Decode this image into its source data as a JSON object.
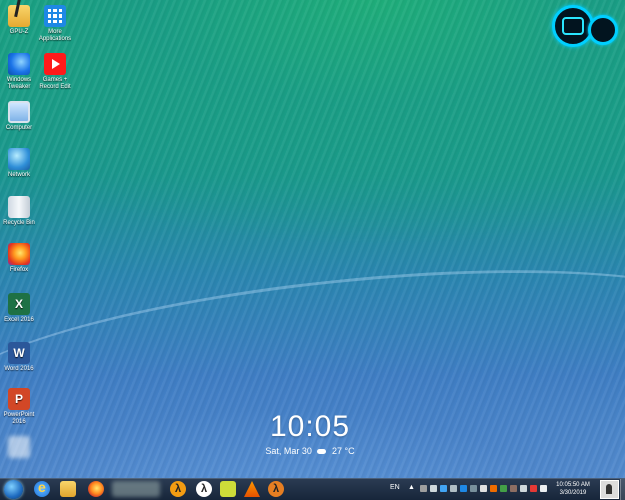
{
  "desktop": {
    "icons": [
      {
        "id": "gpuz",
        "label": "GPU-Z"
      },
      {
        "id": "more-apps",
        "label": "More Applications"
      },
      {
        "id": "windows-tweaker",
        "label": "Windows Tweaker"
      },
      {
        "id": "games",
        "label": "Games + Record Edit"
      },
      {
        "id": "computer",
        "label": "Computer"
      },
      {
        "id": "network",
        "label": "Network"
      },
      {
        "id": "recycle-bin",
        "label": "Recycle Bin"
      },
      {
        "id": "firefox",
        "label": "Firefox"
      },
      {
        "id": "excel",
        "label": "Excel 2016"
      },
      {
        "id": "word",
        "label": "Word 2016"
      },
      {
        "id": "powerpoint",
        "label": "PowerPoint 2016"
      }
    ],
    "office_letters": {
      "excel": "X",
      "word": "W",
      "powerpoint": "P"
    }
  },
  "clock": {
    "time": "10:05",
    "date": "Sat, Mar 30",
    "weather": "27 °C"
  },
  "taskbar": {
    "language": "EN",
    "tray_expand": "▲",
    "time": "10:05:50 AM",
    "date": "3/30/2019",
    "hl_glyph": "λ"
  }
}
